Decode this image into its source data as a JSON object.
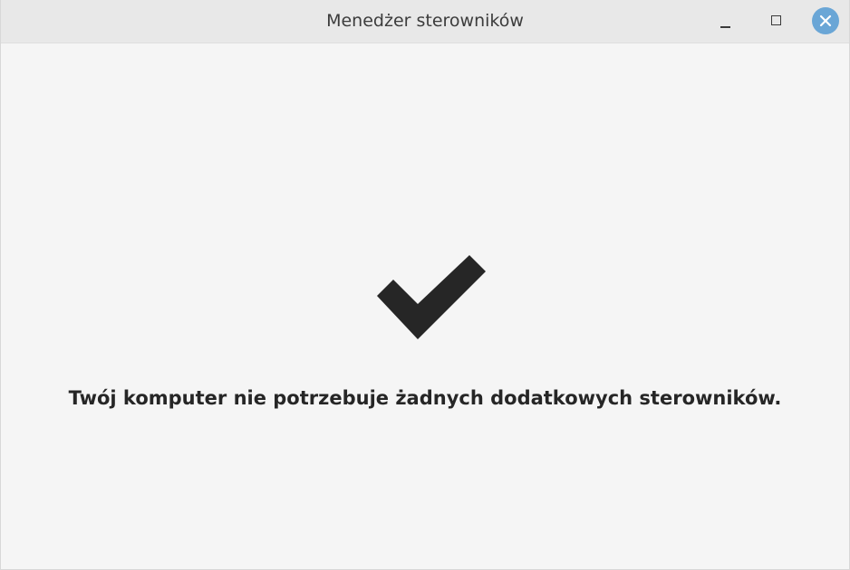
{
  "window": {
    "title": "Menedżer sterowników",
    "controls": {
      "minimize": "minimize",
      "maximize": "maximize",
      "close": "close"
    }
  },
  "main": {
    "status_icon": "checkmark-icon",
    "message": "Twój komputer nie potrzebuje żadnych dodatkowych sterowników."
  },
  "colors": {
    "background": "#f5f5f5",
    "titlebar": "#e8e8e8",
    "close_button": "#6aa6d6",
    "text": "#262626"
  }
}
